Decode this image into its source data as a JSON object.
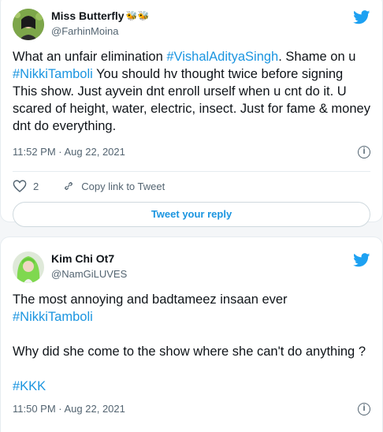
{
  "tweets": [
    {
      "display_name": "Miss Butterfly",
      "name_emoji": "🐝🐝",
      "handle": "@FarhinMoina",
      "text_parts": [
        {
          "t": "What an unfair elimination  ",
          "h": false
        },
        {
          "t": "#VishalAdityaSingh",
          "h": true
        },
        {
          "t": ". Shame on u ",
          "h": false
        },
        {
          "t": "#NikkiTamboli",
          "h": true
        },
        {
          "t": "  You should hv thought twice before signing This show. Just ayvein dnt enroll urself when u cnt do it. U scared of height, water, electric, insect. Just for fame & money dnt do everything.",
          "h": false
        }
      ],
      "timestamp": "11:52 PM · Aug 22, 2021",
      "like_count": "2",
      "copy_link_label": "Copy link to Tweet",
      "reply_button_label": "Tweet your reply"
    },
    {
      "display_name": "Kim Chi Ot7",
      "handle": "@NamGiLUVES",
      "line1": "The most annoying and badtameez insaan ever",
      "hashtag1": "#NikkiTamboli",
      "line2": "Why did she come to the show where she can't do anything  ?",
      "hashtag2": "#KKK",
      "timestamp": "11:50 PM · Aug 22, 2021"
    }
  ],
  "colors": {
    "hashtag": "#1b95e0",
    "twitter_blue": "#1da1f2",
    "secondary_text": "#536471"
  },
  "icons": [
    "twitter-bird-icon",
    "heart-icon",
    "link-icon",
    "info-icon"
  ]
}
